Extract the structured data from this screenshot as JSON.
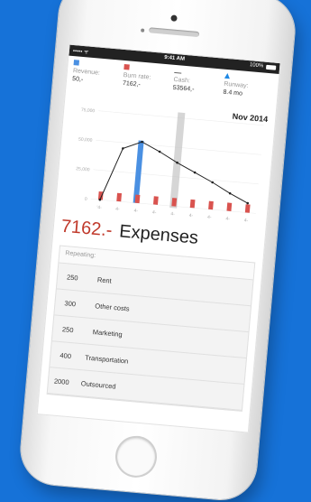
{
  "status": {
    "carrier": "••••• ᯤ",
    "time": "9:41 AM",
    "battery": "100%"
  },
  "metrics": [
    {
      "label": "Revenue:",
      "value": "50,-",
      "color": "#4a90e2"
    },
    {
      "label": "Burn rate:",
      "value": "7162,-",
      "color": "#d9534f"
    },
    {
      "label": "Cash:",
      "value": "53564,-",
      "color": "#666666"
    },
    {
      "label": "Runway:",
      "value": "8.4 mo",
      "color": "#1e88e5"
    }
  ],
  "chart_data": {
    "type": "bar",
    "title": "Nov 2014",
    "y_ticks": [
      "75,000",
      "50,000",
      "25,000",
      "0"
    ],
    "ylim": [
      0,
      75000
    ],
    "categories": [
      "Jul",
      "Aug",
      "Sep",
      "Oct",
      "Nov",
      "Dec",
      "Jan",
      "Feb",
      "Mar"
    ],
    "x_tick_labels": [
      "'4-",
      "4-",
      "4-",
      "4-",
      "4-",
      "4-",
      "4-",
      "4-",
      "4-"
    ],
    "series": [
      {
        "type": "bar",
        "color": "#4a90e2",
        "values": [
          0,
          0,
          53000,
          0,
          0,
          0,
          0,
          0,
          0
        ]
      },
      {
        "type": "bar",
        "color": "#d9534f",
        "values": [
          7000,
          7000,
          7000,
          7000,
          7000,
          7000,
          7000,
          7000,
          7000
        ]
      },
      {
        "type": "line",
        "color": "#222222",
        "values": [
          0,
          45000,
          52000,
          45000,
          37000,
          30000,
          23000,
          15000,
          8000
        ]
      }
    ],
    "highlight_index": 4,
    "highlight_color": "#bbbbbb"
  },
  "expenses": {
    "amount": "7162.-",
    "title": "Expenses",
    "list_header": "Repeating:",
    "items": [
      {
        "amount": "250",
        "category": "Rent"
      },
      {
        "amount": "300",
        "category": "Other costs"
      },
      {
        "amount": "250",
        "category": "Marketing"
      },
      {
        "amount": "400",
        "category": "Transportation"
      },
      {
        "amount": "2000",
        "category": "Outsourced"
      }
    ]
  }
}
